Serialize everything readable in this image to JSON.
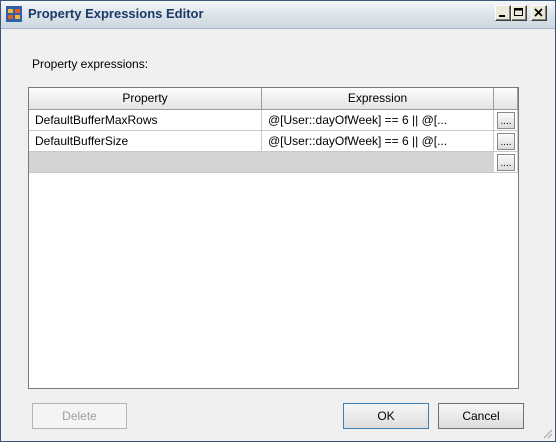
{
  "window": {
    "title": "Property Expressions Editor"
  },
  "labels": {
    "property_expressions": "Property expressions:"
  },
  "grid": {
    "columns": [
      "Property",
      "Expression",
      ""
    ],
    "rows": [
      {
        "property": "DefaultBufferMaxRows",
        "expression": "@[User::dayOfWeek] == 6 || @[..."
      },
      {
        "property": "DefaultBufferSize",
        "expression": "@[User::dayOfWeek] == 6 || @[..."
      }
    ],
    "ellipsis_label": "...."
  },
  "buttons": {
    "delete": "Delete",
    "ok": "OK",
    "cancel": "Cancel"
  },
  "icons": {
    "app": "property-editor-icon",
    "minimize": "minimize-icon",
    "maximize": "maximize-icon",
    "close": "close-icon"
  }
}
